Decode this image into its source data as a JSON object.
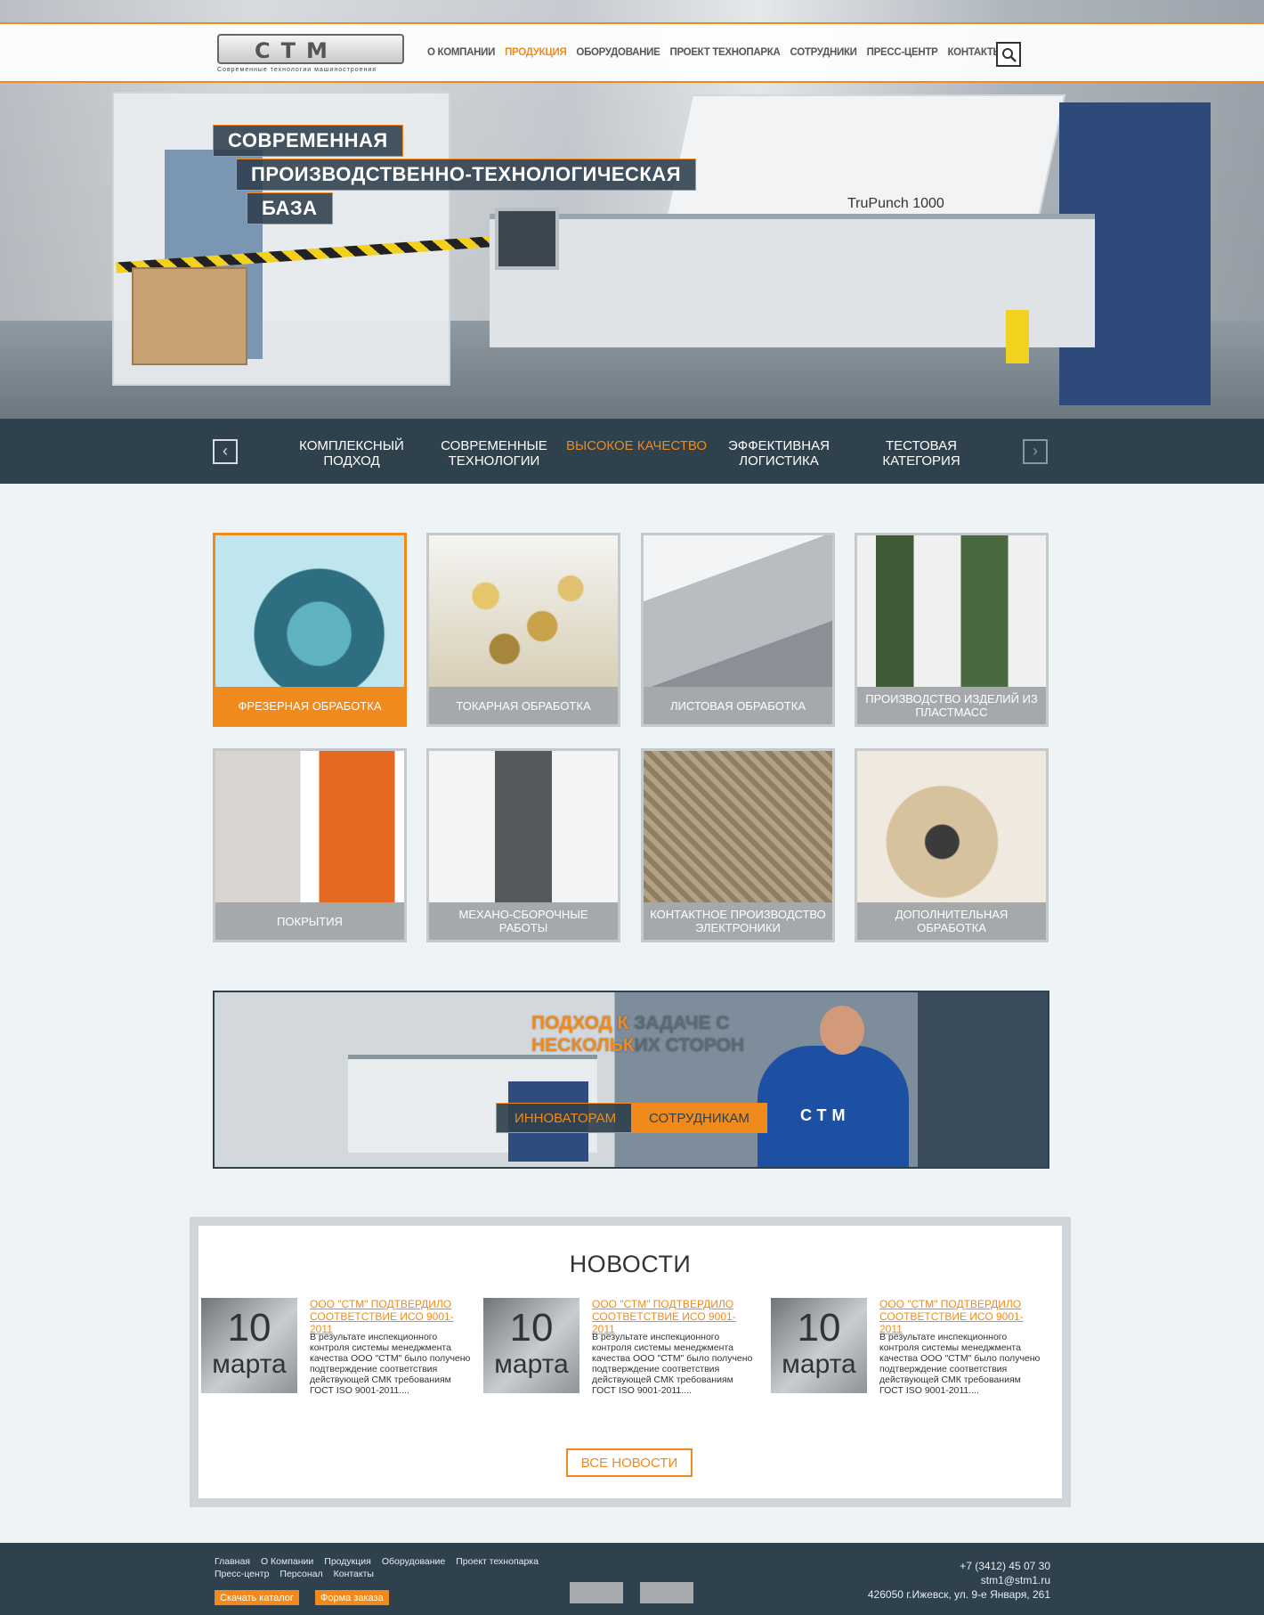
{
  "header": {
    "logo_text": "СТМ",
    "logo_tagline": "Современные технологии машиностроения",
    "nav": [
      "О КОМПАНИИ",
      "ПРОДУКЦИЯ",
      "ОБОРУДОВАНИЕ",
      "ПРОЕКТ ТЕХНОПАРКА",
      "СОТРУДНИКИ",
      "ПРЕСС-ЦЕНТР",
      "КОНТАКТЫ"
    ],
    "active_nav": "ПРОДУКЦИЯ",
    "search_icon": "search-icon"
  },
  "hero": {
    "slogan": [
      "СОВРЕМЕННАЯ",
      "ПРОИЗВОДСТВЕННО-ТЕХНОЛОГИЧЕСКАЯ",
      "БАЗА"
    ],
    "machine_brand": "TruPunch 1000"
  },
  "tabs": {
    "items": [
      "КОМПЛЕКСНЫЙ ПОДХОД",
      "СОВРЕМЕННЫЕ ТЕХНОЛОГИИ",
      "ВЫСОКОЕ КАЧЕСТВО",
      "ЭФФЕКТИВНАЯ ЛОГИСТИКА",
      "ТЕСТОВАЯ КАТЕГОРИЯ"
    ],
    "active": "ВЫСОКОЕ КАЧЕСТВО",
    "prev_icon": "chevron-left-icon",
    "next_icon": "chevron-right-icon"
  },
  "services": [
    "ФРЕЗЕРНАЯ ОБРАБОТКА",
    "ТОКАРНАЯ ОБРАБОТКА",
    "ЛИСТОВАЯ ОБРАБОТКА",
    "ПРОИЗВОДСТВО ИЗДЕЛИЙ ИЗ ПЛАСТМАСС",
    "ПОКРЫТИЯ",
    "МЕХАНО-СБОРОЧНЫЕ РАБОТЫ",
    "КОНТАКТНОЕ ПРОИЗВОДСТВО ЭЛЕКТРОНИКИ",
    "ДОПОЛНИТЕЛЬНАЯ ОБРАБОТКА"
  ],
  "promo": {
    "title_line1_orange": "ПОДХОД К",
    "title_line1_gray": " ЗАДАЧЕ С",
    "title_line2_orange": "НЕСКОЛЬК",
    "title_line2_gray": "ИХ СТОРОН",
    "btn_left": "ИННОВАТОРАМ",
    "btn_right": "СОТРУДНИКАМ",
    "jacket_logo": "СТМ"
  },
  "news": {
    "title": "НОВОСТИ",
    "items": [
      {
        "day": "10",
        "month": "марта",
        "link": "ООО \"СТМ\" ПОДТВЕРДИЛО СООТВЕТСТВИЕ ИСО 9001-2011",
        "text": "В результате инспекционного контроля системы менеджмента качества ООО \"СТМ\" было получено подтверждение соответствия действующей СМК требованиям ГОСТ ISO 9001-2011...."
      },
      {
        "day": "10",
        "month": "марта",
        "link": "ООО \"СТМ\" ПОДТВЕРДИЛО СООТВЕТСТВИЕ ИСО 9001-2011",
        "text": "В результате инспекционного контроля системы менеджмента качества ООО \"СТМ\" было получено подтверждение соответствия действующей СМК требованиям ГОСТ ISO 9001-2011...."
      },
      {
        "day": "10",
        "month": "марта",
        "link": "ООО \"СТМ\" ПОДТВЕРДИЛО СООТВЕТСТВИЕ ИСО 9001-2011",
        "text": "В результате инспекционного контроля системы менеджмента качества ООО \"СТМ\" было получено подтверждение соответствия действующей СМК требованиям ГОСТ ISO 9001-2011...."
      }
    ],
    "all_button": "ВСЕ НОВОСТИ"
  },
  "footer": {
    "links": [
      "Главная",
      "О Компании",
      "Продукция",
      "Оборудование",
      "Проект технопарка",
      "Пресс-центр",
      "Персонал",
      "Контакты"
    ],
    "btn_catalog": "Скачать каталог",
    "btn_order": "Форма заказа",
    "phone": "+7 (3412) 45 07 30",
    "email": "stm1@stm1.ru",
    "address": "426050 г.Ижевск, ул. 9-е Января, 261"
  },
  "colors": {
    "accent": "#f08a1c",
    "dark": "#2f414d",
    "card_label": "#a6a9ab"
  }
}
